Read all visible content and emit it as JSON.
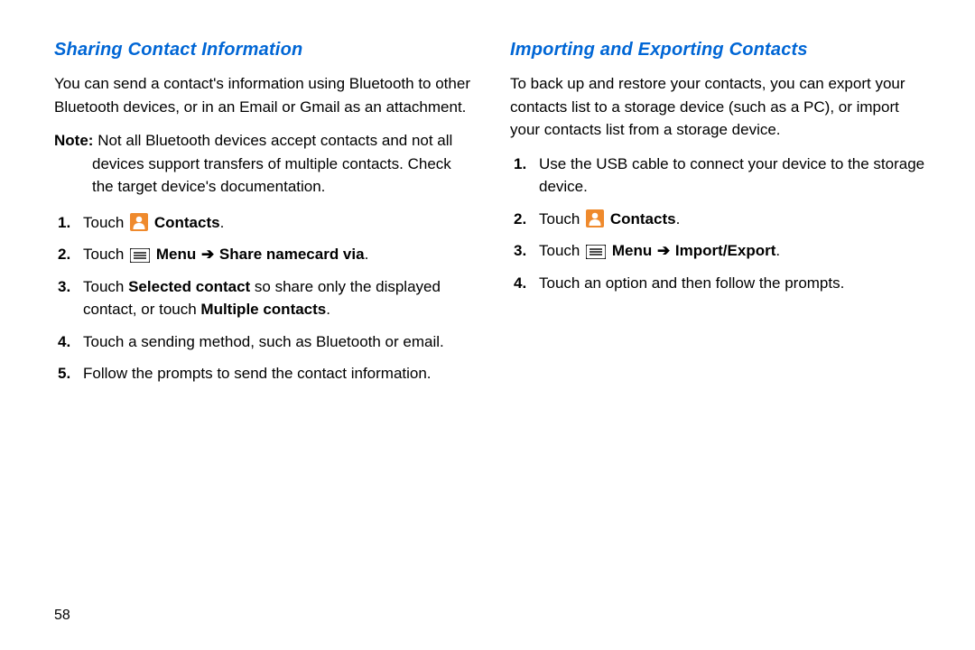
{
  "left": {
    "heading": "Sharing Contact Information",
    "intro": "You can send a contact's information using Bluetooth to other Bluetooth devices, or in an Email or Gmail as an attachment.",
    "note_label": "Note:",
    "note_first": "Not all Bluetooth devices accept contacts and not all",
    "note_rest": "devices support transfers of multiple contacts. Check the target device's documentation.",
    "step1_touch": "Touch ",
    "step1_contacts": "Contacts",
    "step2_touch": "Touch ",
    "step2_menu": "Menu",
    "step2_arrow": " ➔ ",
    "step2_action": "Share namecard via",
    "step3_pre": "Touch ",
    "step3_b1": "Selected contact",
    "step3_mid": " so share only the displayed contact, or touch ",
    "step3_b2": "Multiple contacts",
    "step4": "Touch a sending method, such as Bluetooth or email.",
    "step5": "Follow the prompts to send the contact information.",
    "period": "."
  },
  "right": {
    "heading": "Importing and Exporting Contacts",
    "intro": "To back up and restore your contacts, you can export your contacts list to a storage device (such as a PC), or import your contacts list from a storage device.",
    "step1": "Use the USB cable to connect your device to the storage device.",
    "step2_touch": "Touch ",
    "step2_contacts": "Contacts",
    "step3_touch": "Touch ",
    "step3_menu": "Menu",
    "step3_arrow": " ➔ ",
    "step3_action": "Import/Export",
    "step4": "Touch an option and then follow the prompts.",
    "period": "."
  },
  "page_number": "58"
}
